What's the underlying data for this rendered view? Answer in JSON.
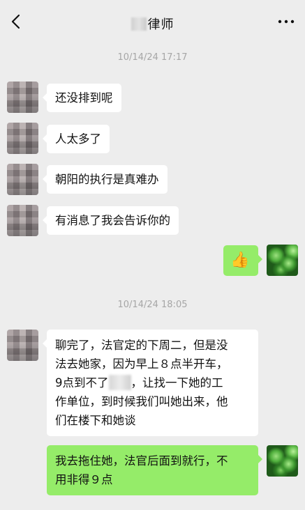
{
  "header": {
    "title": "律师",
    "back_icon": "chevron-left-icon",
    "more_icon": "more-dots-icon"
  },
  "timestamps": [
    "10/14/24 17:17",
    "10/14/24 18:05"
  ],
  "messages": [
    {
      "side": "left",
      "text": "还没排到呢"
    },
    {
      "side": "left",
      "text": "人太多了"
    },
    {
      "side": "left",
      "text": "朝阳的执行是真难办"
    },
    {
      "side": "left",
      "text": "有消息了我会告诉你的"
    },
    {
      "side": "right",
      "emoji": "👍",
      "emoji_name": "thumbs-up"
    },
    {
      "side": "left",
      "text_before": "聊完了，法官定的下周二，但是没\n法去她家，因为早上８点半开车，\n9点到不了",
      "text_after": "，让找一下她的工\n作单位，到时候我们叫她出来，他\n们在楼下和她谈"
    },
    {
      "side": "right",
      "text": "我去拖住她，法官后面到就行，不\n用非得９点"
    }
  ],
  "colors": {
    "background": "#ededed",
    "bubble_left": "#ffffff",
    "bubble_right": "#95ec69",
    "timestamp": "#a6a6a6"
  }
}
